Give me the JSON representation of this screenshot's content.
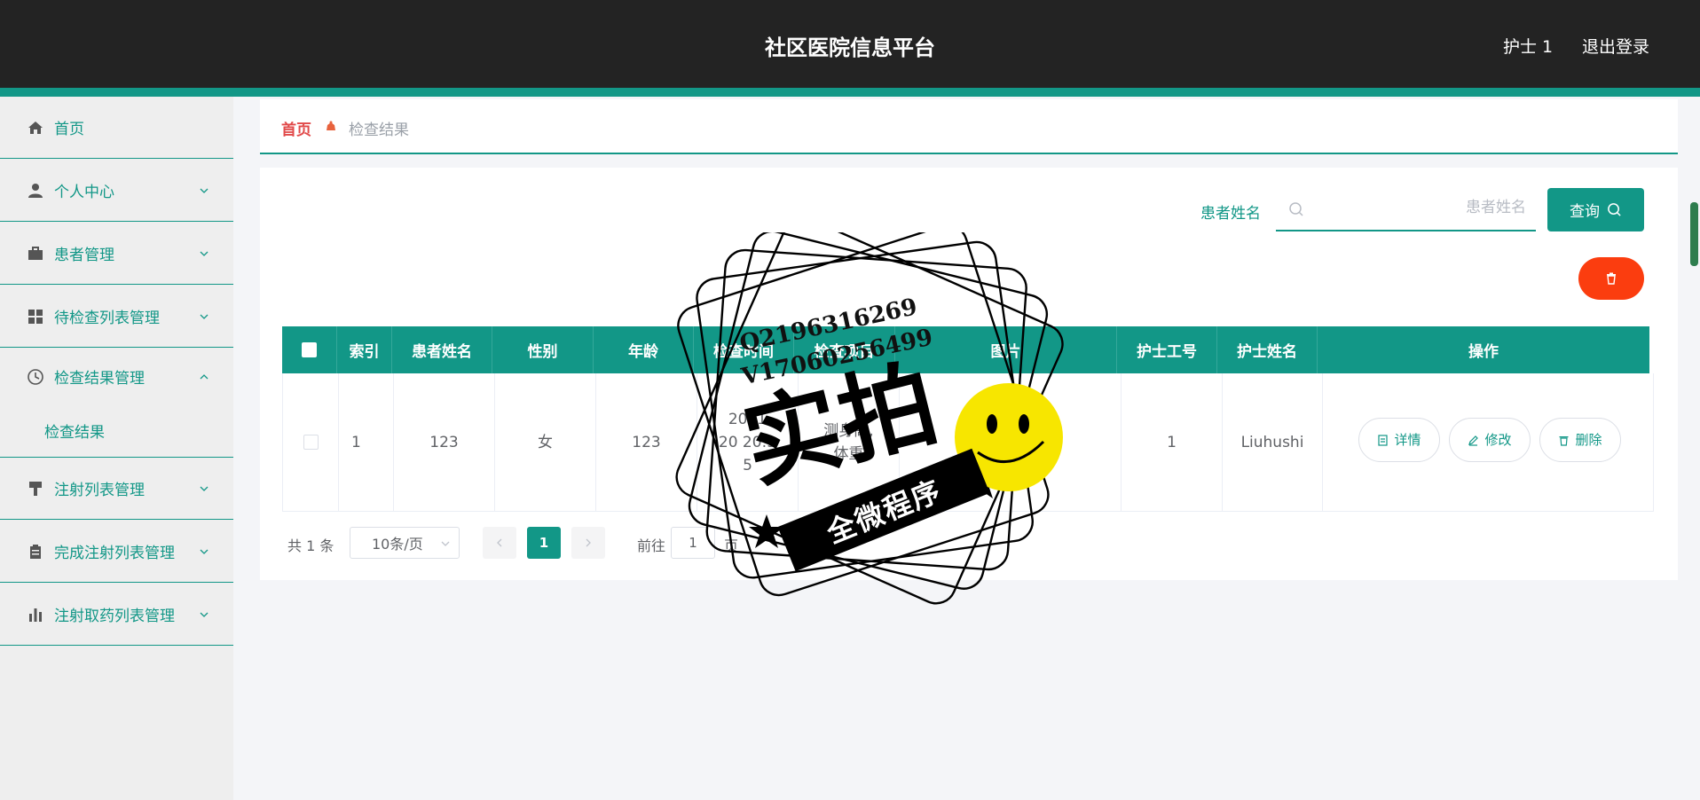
{
  "header": {
    "app_title": "社区医院信息平台",
    "user": "护士 1",
    "logout": "退出登录"
  },
  "sidebar": {
    "items": [
      {
        "label": "首页",
        "icon": "home-icon"
      },
      {
        "label": "个人中心",
        "icon": "user-icon"
      },
      {
        "label": "患者管理",
        "icon": "briefcase-icon"
      },
      {
        "label": "待检查列表管理",
        "icon": "grid-icon"
      },
      {
        "label": "检查结果管理",
        "icon": "clock-icon",
        "expanded": true,
        "children": [
          {
            "label": "检查结果"
          }
        ]
      },
      {
        "label": "注射列表管理",
        "icon": "brush-icon"
      },
      {
        "label": "完成注射列表管理",
        "icon": "clipboard-icon"
      },
      {
        "label": "注射取药列表管理",
        "icon": "bar-chart-icon"
      }
    ]
  },
  "breadcrumb": {
    "home": "首页",
    "current": "检查结果"
  },
  "search": {
    "label": "患者姓名",
    "placeholder": "患者姓名",
    "value": "",
    "button": "查询"
  },
  "table": {
    "columns": [
      "索引",
      "患者姓名",
      "性别",
      "年龄",
      "检查时间",
      "检查项目",
      "图片",
      "护士工号",
      "护士姓名",
      "操作"
    ],
    "rows": [
      {
        "index": "1",
        "patient_name": "123",
        "gender": "女",
        "age": "123",
        "check_time_line1": "2021",
        "check_time_line2": "20 20:3",
        "check_time_line3": "5",
        "check_item_line1": "测身高,",
        "check_item_line2": "体重",
        "nurse_id": "1",
        "nurse_name": "Liuhushi"
      }
    ],
    "actions": {
      "detail": "详情",
      "edit": "修改",
      "delete": "删除"
    }
  },
  "pagination": {
    "total": "共 1 条",
    "page_size": "10条/页",
    "current_page": "1",
    "goto_label": "前往",
    "goto_value": "1",
    "goto_unit": "页"
  },
  "watermark": {
    "qq": "Q2196316269",
    "vx": "V17060256499",
    "big_text": "实拍",
    "banner": "全微程序"
  },
  "colors": {
    "accent": "#129787",
    "header_bg": "#232323",
    "danger": "#fb3d0f",
    "breadcrumb_home": "#e14a4a"
  }
}
